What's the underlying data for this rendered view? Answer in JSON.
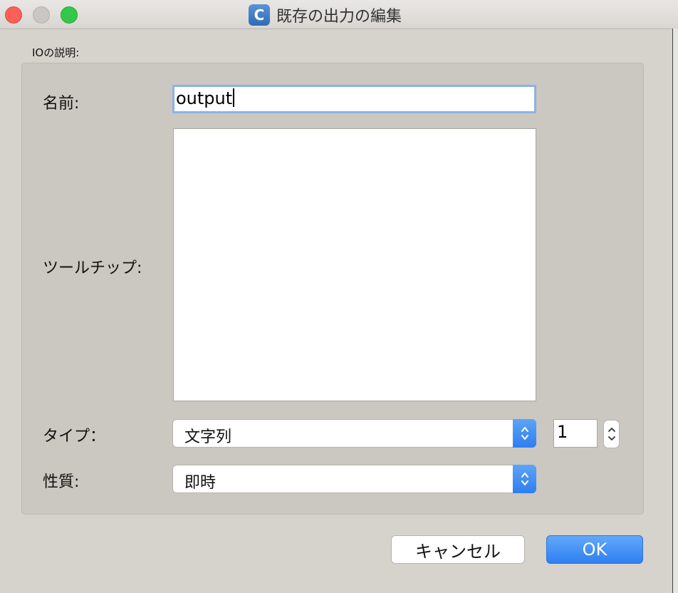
{
  "window": {
    "title": "既存の出力の編集",
    "app_icon_letter": "C"
  },
  "group": {
    "label": "IOの説明:"
  },
  "form": {
    "name_label": "名前:",
    "name_value": "output",
    "tooltip_label": "ツールチップ:",
    "tooltip_value": "",
    "type_label": "タイプ：",
    "type_value": "文字列",
    "count_value": "1",
    "property_label": "性質:",
    "property_value": "即時"
  },
  "buttons": {
    "cancel_label": "キャンセル",
    "ok_label": "OK"
  },
  "colors": {
    "accent": "#2f7ef0",
    "close": "#fc5f57",
    "maximize": "#34c84a"
  },
  "icons": {
    "stepper": "up-down-chevron-icon"
  }
}
